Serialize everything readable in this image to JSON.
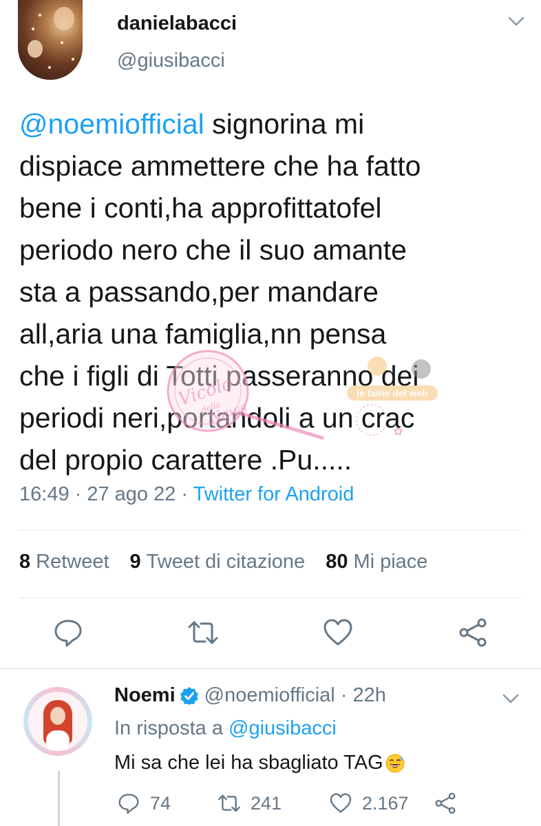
{
  "tweet": {
    "display_name": "danielabacci",
    "handle": "@giusibacci",
    "mention": "@noemiofficial",
    "text": " signorina mi\ndispiace ammettere che ha fatto\nbene i conti,ha approfittatofel\nperiodo nero che il suo amante\nsta a passando,per mandare\nall,aria una famiglia,nn pensa\nche i figli di Totti passeranno dei\nperiodi neri,portandoli a un crac\ndel propio carattere .Pu.....",
    "time": "16:49 · 27 ago 22 · ",
    "source": "Twitter for Android",
    "stats": {
      "retweets_count": "8",
      "retweets_label": "Retweet",
      "quotes_count": "9",
      "quotes_label": "Tweet di citazione",
      "likes_count": "80",
      "likes_label": "Mi piace"
    },
    "icons": {
      "menu": "chevron-down-icon",
      "reply": "reply-icon",
      "retweet": "retweet-icon",
      "like": "heart-icon",
      "share": "share-icon"
    }
  },
  "reply": {
    "display_name": "Noemi",
    "handle_time": "@noemiofficial · 22h",
    "in_reply_prefix": "In risposta a ",
    "in_reply_handle": "@giusibacci",
    "text": "Mi sa che lei ha sbagliato TAG",
    "reply_count": "74",
    "retweet_count": "241",
    "like_count": "2.167"
  },
  "watermark": {
    "script_text": "Vicolo delle News",
    "arc_text": "le faine del web"
  },
  "colors": {
    "accent": "#1da1f2",
    "secondary_text": "#657786",
    "primary_text": "#14171a",
    "divider": "#e1e8ed",
    "verified": "#1da1f2"
  }
}
